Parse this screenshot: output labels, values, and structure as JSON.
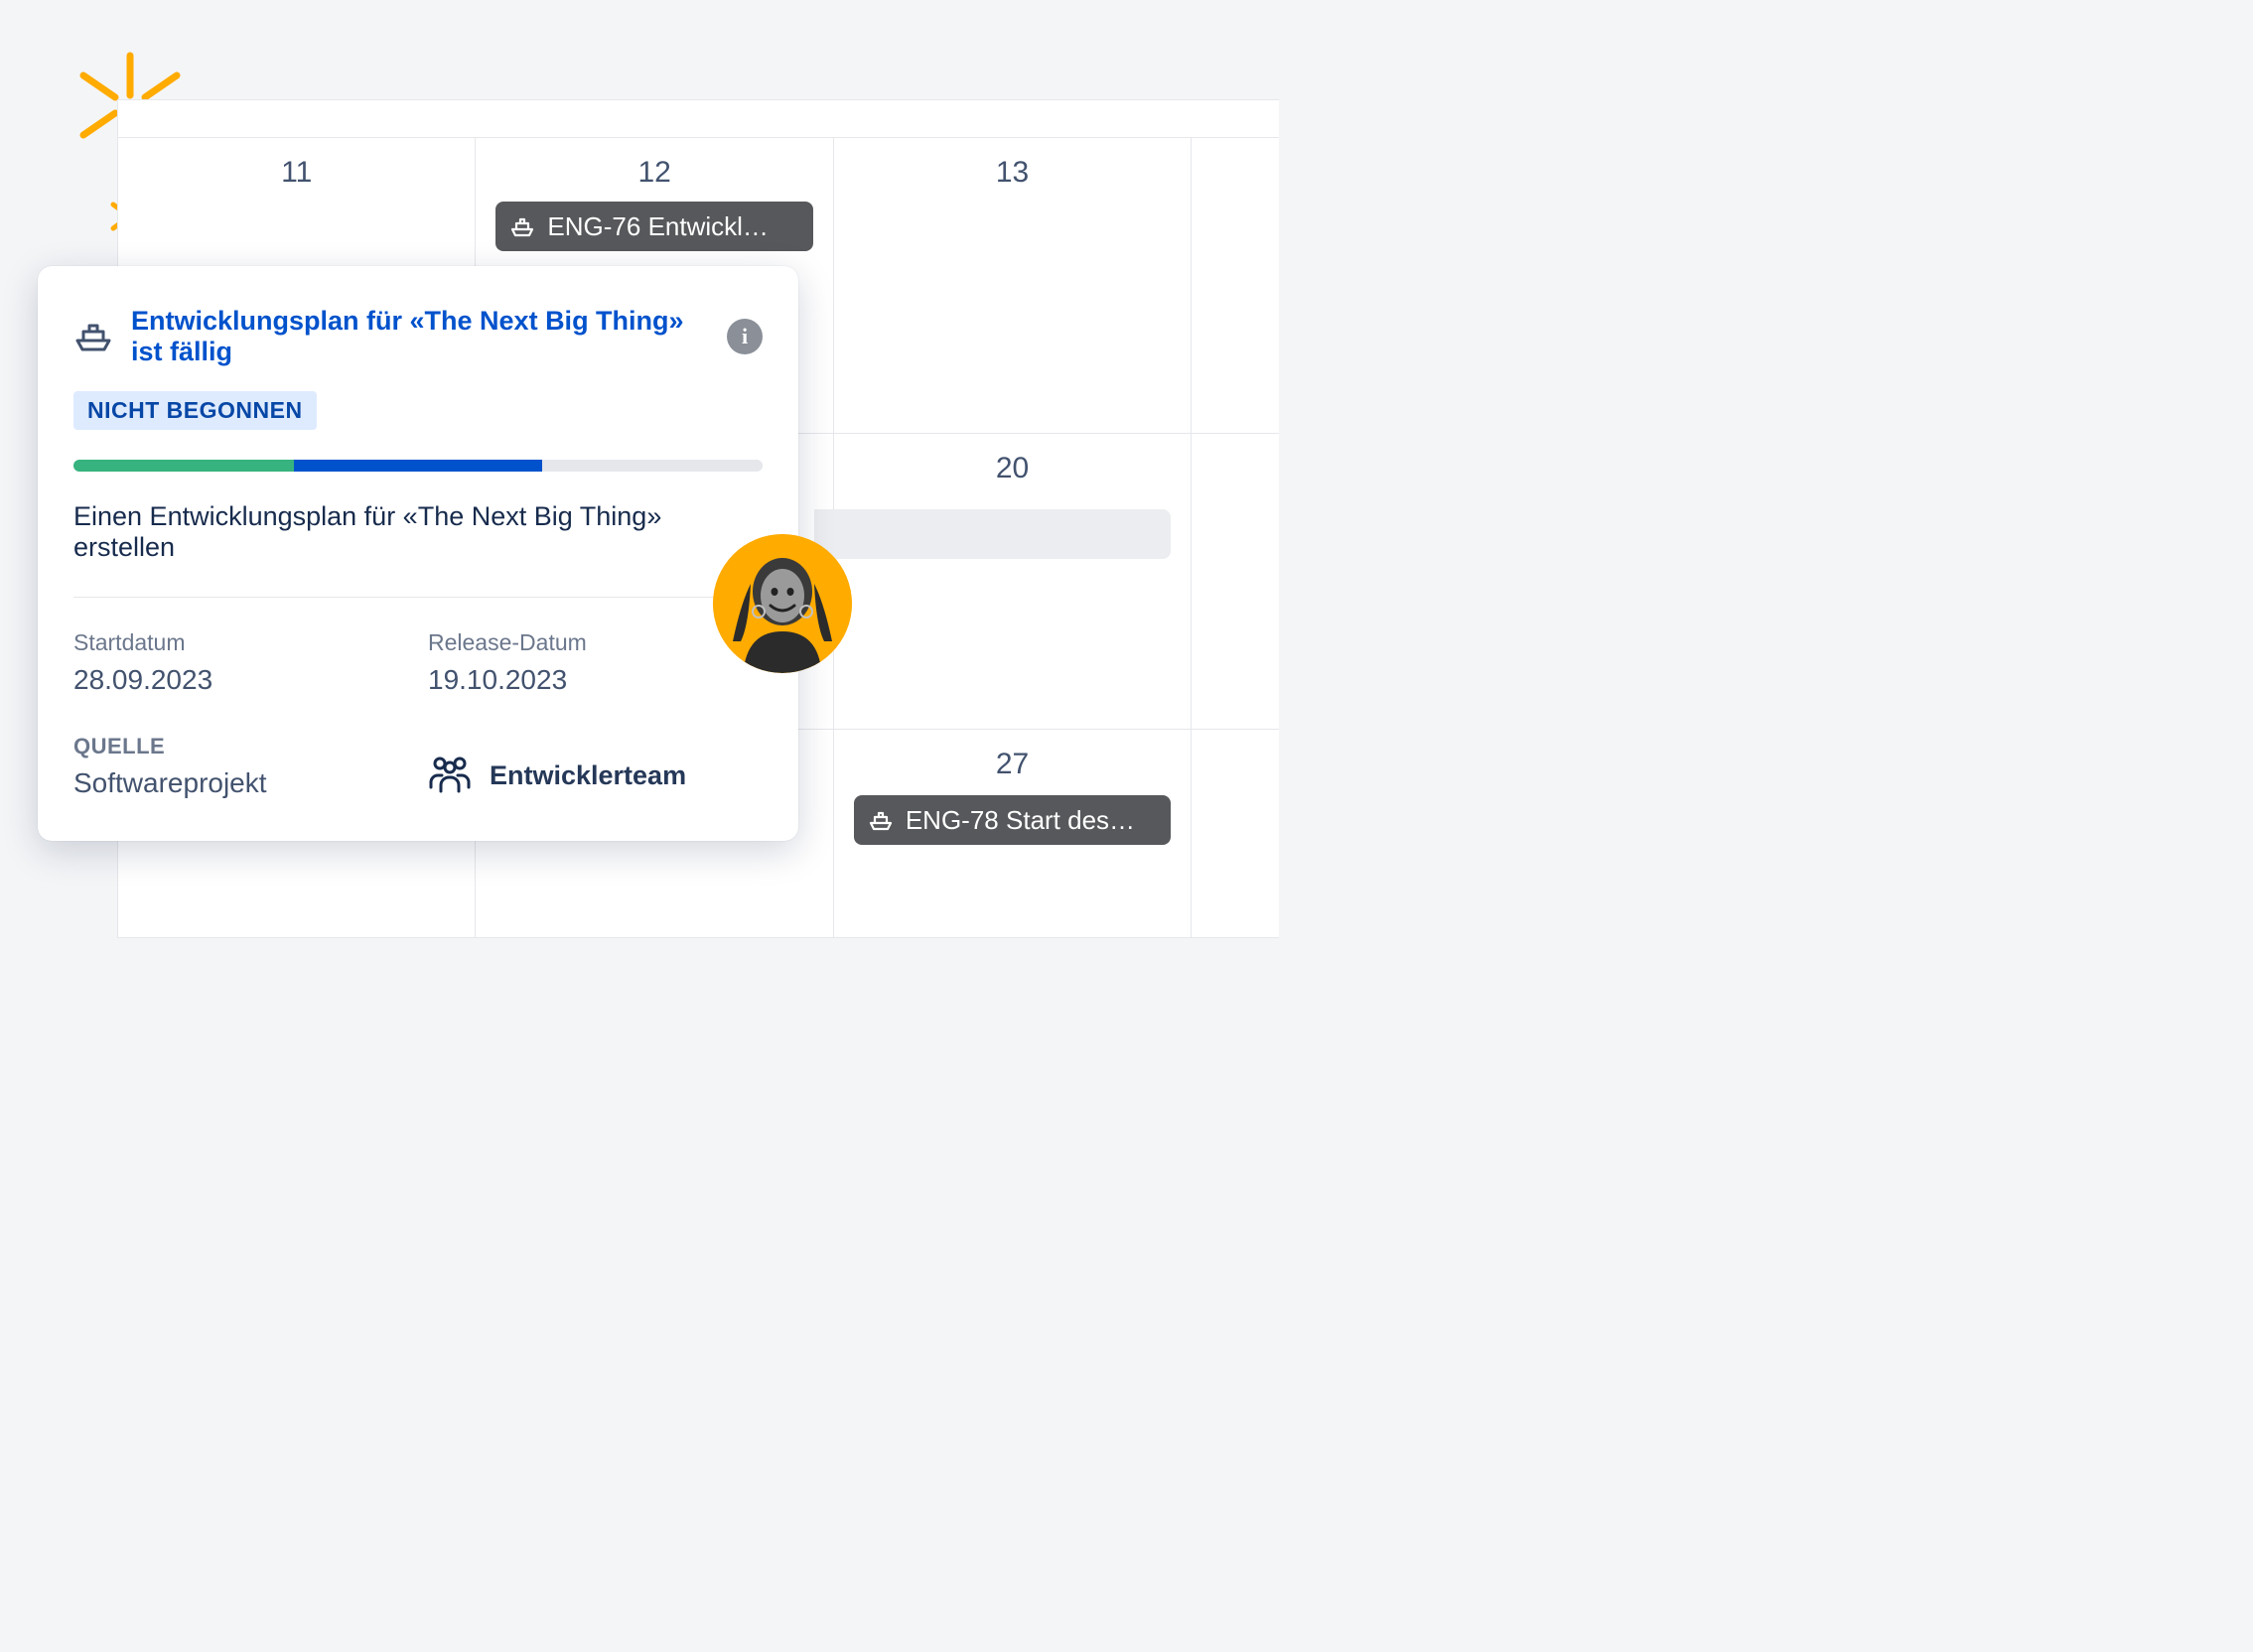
{
  "calendar": {
    "rows": [
      {
        "days": [
          "11",
          "12",
          "13"
        ]
      },
      {
        "days": [
          "",
          "",
          "20"
        ]
      },
      {
        "days": [
          "",
          "",
          "27"
        ]
      }
    ]
  },
  "events": {
    "eng76": {
      "key": "ENG-76",
      "title": "Entwickl…"
    },
    "eng78": {
      "key": "ENG-78",
      "title": "Start des…"
    }
  },
  "popover": {
    "title": "Entwicklungsplan für «The Next Big Thing» ist fällig",
    "status": "NICHT BEGONNEN",
    "description": "Einen Entwicklungsplan für «The Next Big Thing» erstellen",
    "progress": {
      "done_pct": 32,
      "inprogress_pct": 36,
      "done_color": "#36b37e",
      "inprogress_color": "#0052cc",
      "remaining_color": "#dfe1e6"
    },
    "start_label": "Startdatum",
    "start_value": "28.09.2023",
    "release_label": "Release-Datum",
    "release_value": "19.10.2023",
    "source_label": "QUELLE",
    "source_value": "Softwareprojekt",
    "team_label": "Entwicklerteam"
  },
  "colors": {
    "accent_blue": "#0052cc",
    "sparkle": "#ffab00"
  }
}
